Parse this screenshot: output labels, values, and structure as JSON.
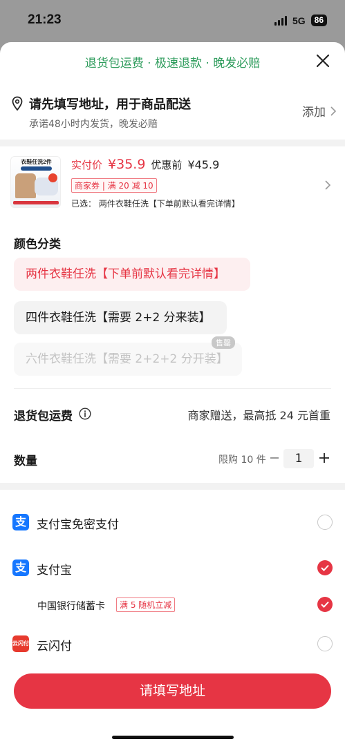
{
  "status": {
    "time": "21:23",
    "network": "5G",
    "battery": "86"
  },
  "banner": {
    "text": "退货包运费 · 极速退款 · 晚发必赔"
  },
  "address": {
    "title": "请先填写地址，用于商品配送",
    "subtitle": "承诺48小时内发货，晚发必赔",
    "action": "添加"
  },
  "product": {
    "thumb_text": "衣鞋任洗2件",
    "price_label": "实付价",
    "price": "¥35.9",
    "old_price_label": "优惠前",
    "old_price": "¥45.9",
    "coupon": "商家券 | 满 20 减 10",
    "selected": "已选：  两件衣鞋任洗【下单前默认看完详情】"
  },
  "options": {
    "title": "颜色分类",
    "items": [
      {
        "label": "两件衣鞋任洗【下单前默认看完详情】",
        "state": "selected"
      },
      {
        "label": "四件衣鞋任洗【需要 2+2 分来装】",
        "state": "normal"
      },
      {
        "label": "六件衣鞋任洗【需要 2+2+2 分开装】",
        "state": "disabled"
      }
    ],
    "sold_out": "售罄"
  },
  "return_shipping": {
    "label": "退货包运费",
    "value": "商家赠送，最高抵 24 元首重"
  },
  "quantity": {
    "label": "数量",
    "limit": "限购 10 件",
    "value": "1"
  },
  "payments": [
    {
      "label": "支付宝免密支付",
      "icon": "alipay-icon",
      "checked": false
    },
    {
      "label": "支付宝",
      "icon": "alipay-icon",
      "checked": true
    },
    {
      "label": "云闪付",
      "icon": "unionpay-icon",
      "checked": false
    }
  ],
  "bank": {
    "label": "中国银行储蓄卡",
    "promo": "满 5 随机立减",
    "checked": true
  },
  "cta": {
    "label": "请填写地址"
  },
  "colors": {
    "accent": "#e63544",
    "banner_green": "#2e9c5c",
    "alipay_blue": "#1677ff"
  }
}
